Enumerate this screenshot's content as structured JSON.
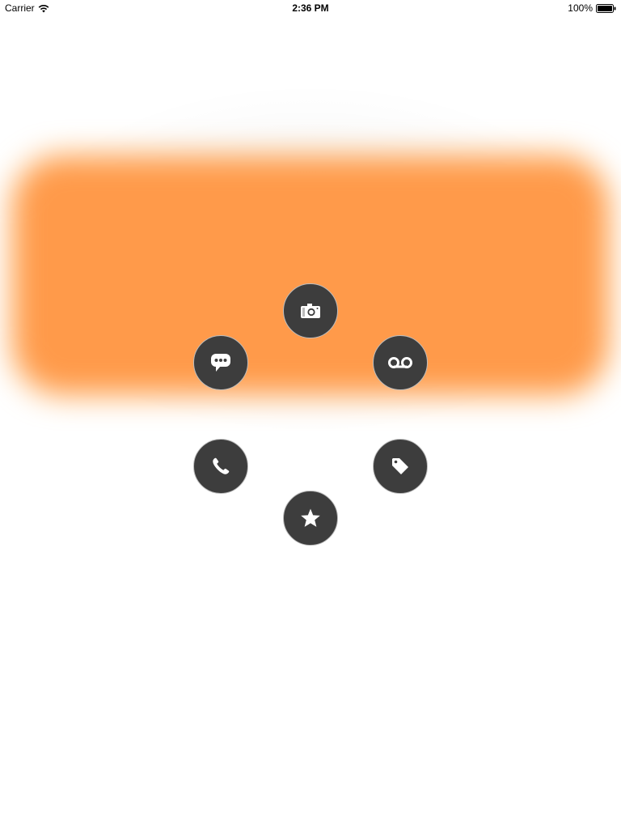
{
  "status_bar": {
    "carrier": "Carrier",
    "time": "2:36 PM",
    "battery_percent": "100%",
    "icons": [
      "wifi-icon",
      "battery-icon"
    ]
  },
  "colors": {
    "card": "#ff9a4a",
    "card_glow": "#ffb03c",
    "button_bg": "#3d3d3d",
    "button_border": "#bdbdbd",
    "icon": "#ffffff"
  },
  "radial_menu": {
    "items": [
      {
        "name": "camera",
        "icon": "camera-icon"
      },
      {
        "name": "voicemail",
        "icon": "voicemail-icon"
      },
      {
        "name": "tag",
        "icon": "tag-icon"
      },
      {
        "name": "favorite",
        "icon": "star-icon"
      },
      {
        "name": "phone",
        "icon": "phone-icon"
      },
      {
        "name": "message",
        "icon": "chat-bubble-icon"
      }
    ]
  }
}
